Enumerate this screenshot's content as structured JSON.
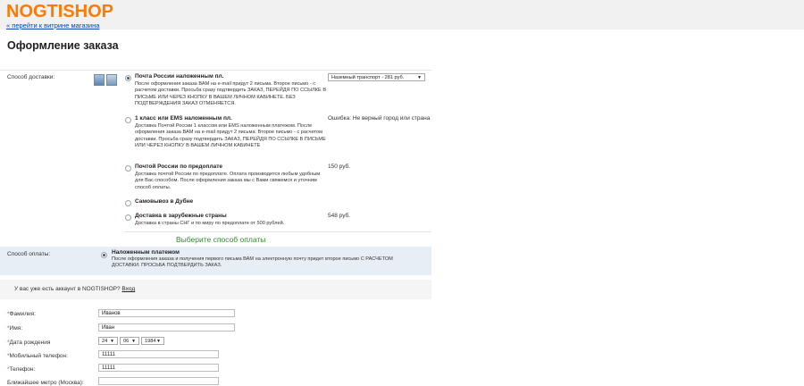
{
  "header": {
    "logo": "NOGTISHOP",
    "back_link": "« перейти к витрине магазина"
  },
  "page_title": "Оформление заказа",
  "delivery": {
    "label": "Способ доставки:",
    "options": [
      {
        "title": "Почта России наложенным пл.",
        "desc": "После оформления заказа ВАМ на e-mail придут 2 письма. Второе письмо - с расчетом доставки. Просьба сразу подтвердить ЗАКАЗ, ПЕРЕЙДЯ ПО ССЫЛКЕ В ПИСЬМЕ ИЛИ ЧЕРЕЗ КНОПКУ В ВАШЕМ ЛИЧНОМ КАБИНЕТЕ. БЕЗ ПОДТВЕРЖДЕНИЯ ЗАКАЗ ОТМЕНЯЕТСЯ.",
        "price": "",
        "selected": true
      },
      {
        "title": "1 класс или EMS наложенным пл.",
        "desc": "Доставка Почтой России 1 классом или EMS наложенным платежом. После оформления заказа ВАМ на e-mail придут 2 письма. Второе письмо - с расчетом доставки. Просьба сразу подтвердить ЗАКАЗ, ПЕРЕЙДЯ ПО ССЫЛКЕ В ПИСЬМЕ ИЛИ ЧЕРЕЗ КНОПКУ В ВАШЕМ ЛИЧНОМ КАБИНЕТЕ",
        "price": "Ошибка: Не верный город или страна",
        "selected": false
      },
      {
        "title": "Почтой России по предоплате",
        "desc": "Доставка почтой России по предоплате. Оплата производится любым удобным для Вас способом. После оформления заказа мы с Вами свяжемся и уточним способ оплаты.",
        "price": "150 руб.",
        "selected": false
      },
      {
        "title": "Самовывоз в Дубне",
        "desc": "",
        "price": "",
        "selected": false
      },
      {
        "title": "Доставка в зарубежные страны",
        "desc": "Доставка в страны СНГ и по миру по предоплате от 500 рублей.",
        "price": "548 руб.",
        "selected": false
      }
    ],
    "transport_select": "Наземный транспорт - 281 руб."
  },
  "choose_payment": "Выберите способ оплаты",
  "payment": {
    "label": "Способ оплаты:",
    "title": "Наложенным платежом",
    "desc": "После оформления заказа и получения первого письма ВАМ на электронную почту придет второе письмо С РАСЧЕТОМ ДОСТАВКИ. ПРОСЬБА ПОДТВЕРДИТЬ ЗАКАЗ."
  },
  "account": {
    "text": "У вас уже есть аккаунт в NOGTISHOP?",
    "link": "Вход"
  },
  "form": {
    "required_mark": "*",
    "last_name": {
      "label": "Фамилия:",
      "value": "Иванов"
    },
    "first_name": {
      "label": "Имя:",
      "value": "Иван"
    },
    "birth": {
      "label": "Дата рождения",
      "day": "24",
      "month": "06",
      "year": "1984"
    },
    "mobile": {
      "label": "Мобильный телефон:",
      "value": "11111"
    },
    "phone": {
      "label": "Телефон:",
      "value": "11111"
    },
    "metro": {
      "label": "Ближайшее метро (Москва):",
      "value": ""
    }
  },
  "colors": {
    "logo": "#ff7a00",
    "choose_payment": "#2e8b2e",
    "required": "#e03a2e",
    "payment_bg": "#e8eef5"
  }
}
